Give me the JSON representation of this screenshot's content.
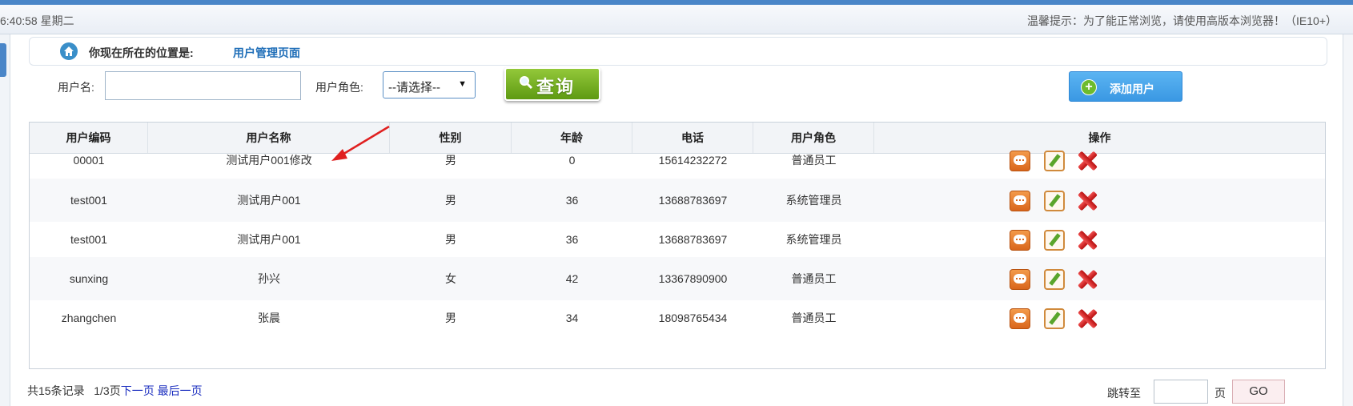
{
  "header": {
    "clock": "6:40:58 星期二",
    "tip": "温馨提示：为了能正常浏览，请使用高版本浏览器！（IE10+）"
  },
  "location": {
    "label": "你现在所在的位置是:",
    "page": "用户管理页面"
  },
  "search": {
    "username_label": "用户名:",
    "username_value": "",
    "role_label": "用户角色:",
    "role_selected": "--请选择--",
    "query_label": "查询",
    "add_label": "添加用户"
  },
  "table": {
    "columns": [
      "用户编码",
      "用户名称",
      "性别",
      "年龄",
      "电话",
      "用户角色",
      "操作"
    ],
    "rows": [
      {
        "code": "00001",
        "name": "测试用户001修改",
        "gender": "男",
        "age": "0",
        "phone": "15614232272",
        "role": "普通员工"
      },
      {
        "code": "test001",
        "name": "测试用户001",
        "gender": "男",
        "age": "36",
        "phone": "13688783697",
        "role": "系统管理员"
      },
      {
        "code": "test001",
        "name": "测试用户001",
        "gender": "男",
        "age": "36",
        "phone": "13688783697",
        "role": "系统管理员"
      },
      {
        "code": "sunxing",
        "name": "孙兴",
        "gender": "女",
        "age": "42",
        "phone": "13367890900",
        "role": "普通员工"
      },
      {
        "code": "zhangchen",
        "name": "张晨",
        "gender": "男",
        "age": "34",
        "phone": "18098765434",
        "role": "普通员工"
      }
    ]
  },
  "pagination": {
    "total": "共15条记录",
    "pages": "1/3页",
    "next": "下一页",
    "last": "最后一页",
    "jump_label": "跳转至",
    "page_unit": "页",
    "go": "GO"
  },
  "icons": {
    "home": "home-icon",
    "search": "magnifier-icon",
    "add": "plus-icon",
    "view": "view-detail-icon",
    "edit": "edit-pencil-icon",
    "delete": "delete-x-icon",
    "annotation": "red-arrow-icon"
  },
  "colors": {
    "accent": "#4a86c8",
    "link": "#1f6eb8",
    "query_button": "#7ab52a",
    "add_button": "#3a98e3",
    "annotation_arrow": "#e02020"
  }
}
